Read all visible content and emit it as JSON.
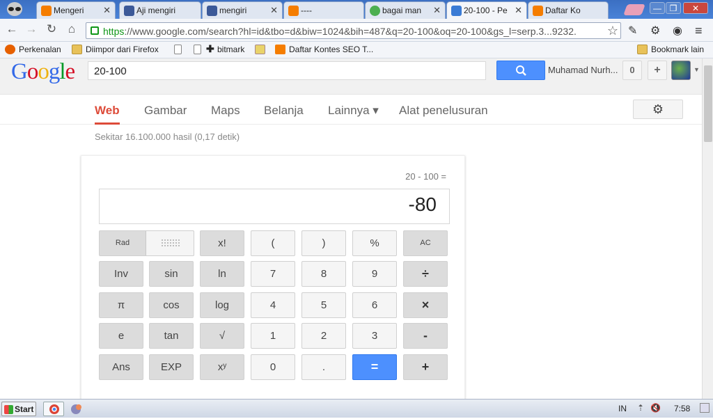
{
  "tabs": [
    {
      "label": "Mengeri",
      "icon": "blogger-icon"
    },
    {
      "label": "Aji mengiri",
      "icon": "facebook-icon"
    },
    {
      "label": "mengiri",
      "icon": "facebook-icon"
    },
    {
      "label": "----",
      "icon": "blogger-icon"
    },
    {
      "label": "bagai man",
      "icon": "question-icon"
    },
    {
      "label": "20-100 - Pe",
      "icon": "google-icon"
    },
    {
      "label": "Daftar Ko",
      "icon": "blogger-icon"
    }
  ],
  "window_controls": {
    "minimize": "—",
    "restore": "❐",
    "close": "✕"
  },
  "toolbar": {
    "url_https": "https",
    "url_rest": "://www.google.com/search?hl=id&tbo=d&biw=1024&bih=487&q=20-100&oq=20-100&gs_l=serp.3...9232."
  },
  "bookmarks": [
    {
      "label": "Perkenalan",
      "icon": "firefox-icon"
    },
    {
      "label": "Diimpor dari Firefox",
      "icon": "folder-icon"
    },
    {
      "label": "",
      "icon": "page-icon"
    },
    {
      "label": "bitmark",
      "icon": "plus-icon"
    },
    {
      "label": "",
      "icon": "page-icon"
    },
    {
      "label": "Daftar Kontes SEO T...",
      "icon": "blogger-icon"
    }
  ],
  "bookmarks_other": "Bookmark lain",
  "google": {
    "logo": "Google",
    "query": "20-100",
    "user": "Muhamad Nurh...",
    "notif_count": "0",
    "share_label": "+"
  },
  "nav_tabs": [
    "Web",
    "Gambar",
    "Maps",
    "Belanja",
    "Lainnya ▾",
    "Alat penelusuran"
  ],
  "stats": "Sekitar 16.100.000 hasil (0,17 detik)",
  "calculator": {
    "expression": "20 - 100 =",
    "result": "-80",
    "rad_label": "Rad",
    "rows": [
      [
        "x!",
        "(",
        ")",
        "%",
        "AC"
      ],
      [
        "Inv",
        "sin",
        "ln",
        "7",
        "8",
        "9",
        "÷"
      ],
      [
        "π",
        "cos",
        "log",
        "4",
        "5",
        "6",
        "×"
      ],
      [
        "e",
        "tan",
        "√",
        "1",
        "2",
        "3",
        "-"
      ],
      [
        "Ans",
        "EXP",
        "xʸ",
        "0",
        ".",
        "=",
        "+"
      ]
    ]
  },
  "taskbar": {
    "start": "Start",
    "lang": "IN",
    "time": "7:58"
  },
  "colors": {
    "accent_red": "#dd4b39",
    "button_blue": "#4d90fe"
  }
}
